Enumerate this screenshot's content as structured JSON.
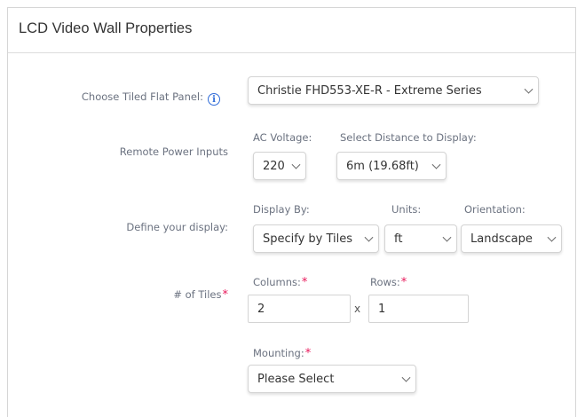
{
  "header": {
    "title": "LCD Video Wall Properties"
  },
  "panel_select": {
    "label": "Choose Tiled Flat Panel:",
    "value": "Christie FHD553-XE-R - Extreme Series",
    "info_icon": "info-icon"
  },
  "power": {
    "label": "Remote Power Inputs",
    "voltage_label": "AC Voltage:",
    "voltage_value": "220",
    "distance_label": "Select Distance to Display:",
    "distance_value": "6m (19.68ft)"
  },
  "display": {
    "label": "Define your display:",
    "display_by_label": "Display By:",
    "display_by_value": "Specify by Tiles",
    "units_label": "Units:",
    "units_value": "ft",
    "orientation_label": "Orientation:",
    "orientation_value": "Landscape"
  },
  "tiles": {
    "label": "# of Tiles",
    "required": "*",
    "columns_label": "Columns:",
    "columns_value": "2",
    "times": "x",
    "rows_label": "Rows:",
    "rows_value": "1"
  },
  "mounting": {
    "label": "Mounting:",
    "value": "Please Select"
  },
  "colors": {
    "accent": "#2f6bd8",
    "required": "#e8185a"
  }
}
